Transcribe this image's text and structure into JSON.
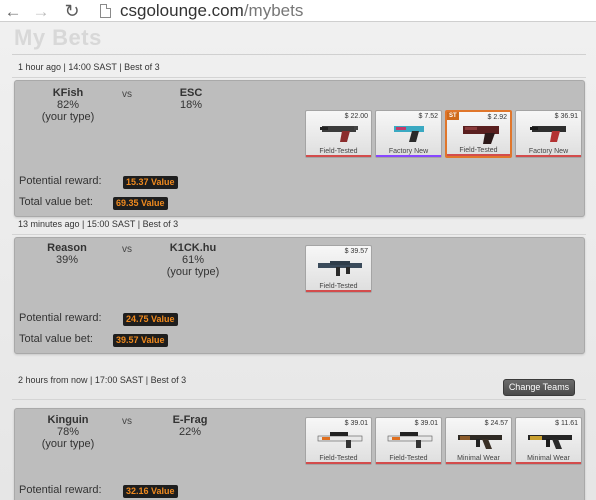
{
  "browser": {
    "url_host": "csgolounge.com",
    "url_path": "/mybets"
  },
  "page": {
    "title": "My Bets"
  },
  "colors": {
    "value_badge_bg": "#1e1e1e",
    "value_badge_text": "#f08a1e",
    "rarity_classified": "#d34c4c",
    "rarity_restricted": "#8847ff",
    "selected_border": "#e0762b"
  },
  "bets": [
    {
      "meta": "1 hour ago | 14:00 SAST | Best of 3",
      "team1": {
        "name": "KFish",
        "percent": "82%",
        "note": "(your type)"
      },
      "vs": "vs",
      "team2": {
        "name": "ESC",
        "percent": "18%",
        "note": ""
      },
      "potential_label": "Potential reward:",
      "potential_value": "15.37 Value",
      "total_label": "Total value bet:",
      "total_value": "69.35 Value",
      "items": [
        {
          "price": "$ 22.00",
          "condition": "Field-Tested",
          "rarity": "classified",
          "icon": "pistol-icon"
        },
        {
          "price": "$ 7.52",
          "condition": "Factory New",
          "rarity": "restricted",
          "icon": "pistol-icon"
        },
        {
          "price": "$ 2.92",
          "condition": "Field-Tested",
          "rarity": "classified",
          "icon": "pistol-icon",
          "stattrak": "ST"
        },
        {
          "price": "$ 36.91",
          "condition": "Factory New",
          "rarity": "classified",
          "icon": "pistol-icon"
        }
      ]
    },
    {
      "meta": "13 minutes ago | 15:00 SAST | Best of 3",
      "team1": {
        "name": "Reason",
        "percent": "39%",
        "note": ""
      },
      "vs": "vs",
      "team2": {
        "name": "K1CK.hu",
        "percent": "61%",
        "note": "(your type)"
      },
      "potential_label": "Potential reward:",
      "potential_value": "24.75 Value",
      "total_label": "Total value bet:",
      "total_value": "39.57 Value",
      "items": [
        {
          "price": "$ 39.57",
          "condition": "Field-Tested",
          "rarity": "classified",
          "icon": "rifle-icon"
        }
      ]
    },
    {
      "meta": "2 hours from now | 17:00 SAST | Best of 3",
      "change_button": "Change Teams",
      "team1": {
        "name": "Kinguin",
        "percent": "78%",
        "note": "(your type)"
      },
      "vs": "vs",
      "team2": {
        "name": "E-Frag",
        "percent": "22%",
        "note": ""
      },
      "potential_label": "Potential reward:",
      "potential_value": "32.16 Value",
      "items": [
        {
          "price": "$ 39.01",
          "condition": "Field-Tested",
          "rarity": "classified",
          "icon": "sniper-rifle-icon"
        },
        {
          "price": "$ 39.01",
          "condition": "Field-Tested",
          "rarity": "classified",
          "icon": "sniper-rifle-icon"
        },
        {
          "price": "$ 24.57",
          "condition": "Minimal Wear",
          "rarity": "classified",
          "icon": "rifle-icon"
        },
        {
          "price": "$ 11.61",
          "condition": "Minimal Wear",
          "rarity": "classified",
          "icon": "rifle-icon"
        }
      ]
    }
  ]
}
